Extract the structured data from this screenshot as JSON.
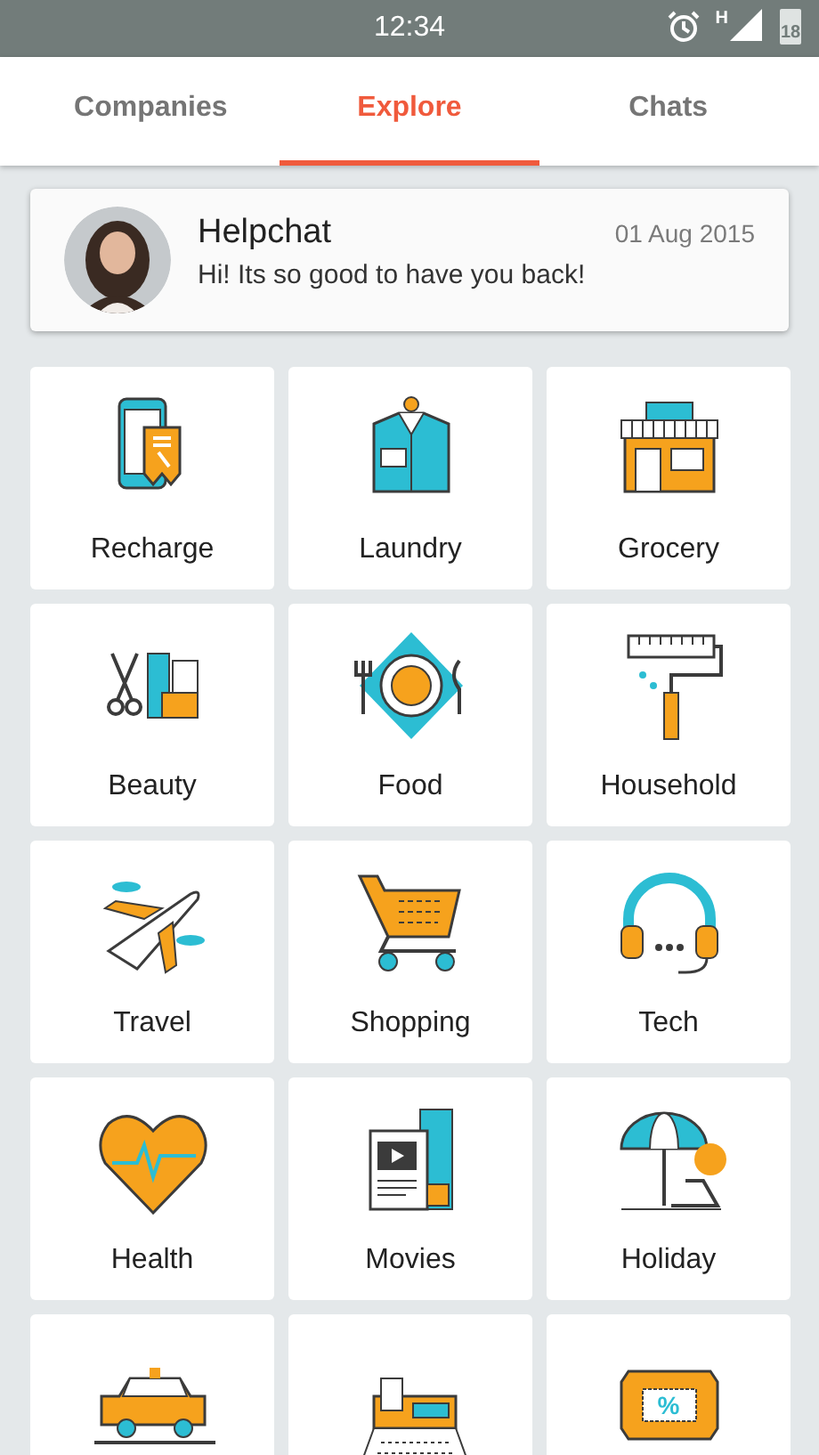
{
  "status_bar": {
    "time": "12:34",
    "network": "H",
    "battery": "18"
  },
  "tabs": [
    {
      "label": "Companies",
      "selected": false
    },
    {
      "label": "Explore",
      "selected": true
    },
    {
      "label": "Chats",
      "selected": false
    }
  ],
  "message": {
    "sender": "Helpchat",
    "date": "01 Aug 2015",
    "text": "Hi! Its so good to have you back!"
  },
  "categories": [
    {
      "kind": "full",
      "label": "Recharge"
    },
    {
      "kind": "full",
      "label": "Laundry"
    },
    {
      "kind": "full",
      "label": "Grocery"
    },
    {
      "kind": "full",
      "label": "Beauty"
    },
    {
      "kind": "full",
      "label": "Food"
    },
    {
      "kind": "full",
      "label": "Household"
    },
    {
      "kind": "full",
      "label": "Travel"
    },
    {
      "kind": "full",
      "label": "Shopping"
    },
    {
      "kind": "full",
      "label": "Tech"
    },
    {
      "kind": "full",
      "label": "Health"
    },
    {
      "kind": "full",
      "label": "Movies"
    },
    {
      "kind": "full",
      "label": "Holiday"
    },
    {
      "kind": "partial"
    },
    {
      "kind": "partial"
    },
    {
      "kind": "partial",
      "sign": "%"
    }
  ]
}
